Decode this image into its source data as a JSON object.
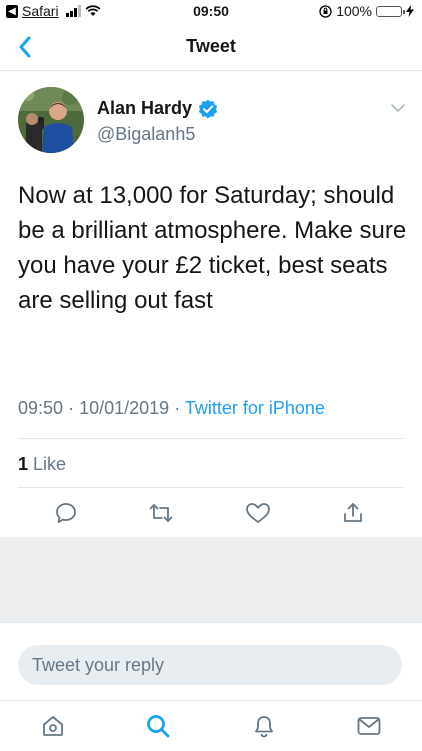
{
  "status_bar": {
    "back_app": "Safari",
    "time": "09:50",
    "battery_percent": "100%",
    "battery_level": 1.0
  },
  "nav": {
    "title": "Tweet"
  },
  "tweet": {
    "author_name": "Alan Hardy",
    "verified": true,
    "handle": "@Bigalanh5",
    "text": "Now at 13,000 for Saturday; should be a brilliant atmosphere. Make sure you have your £2 ticket, best seats are selling out fast",
    "time": "09:50",
    "separator": "·",
    "date": "10/01/2019",
    "source": "Twitter for iPhone",
    "likes_count": "1",
    "likes_label": "Like"
  },
  "actions": {
    "icons": [
      "reply-icon",
      "retweet-icon",
      "like-icon",
      "share-icon"
    ]
  },
  "reply": {
    "placeholder": "Tweet your reply"
  },
  "tab_bar": {
    "tabs": [
      "home-icon",
      "search-icon",
      "notifications-icon",
      "messages-icon"
    ],
    "active_tab": "search-icon"
  },
  "colors": {
    "accent": "#1da1f2",
    "text": "#14171a",
    "secondary_text": "#657786",
    "divider": "#e1e8ed",
    "battery": "#4cd964"
  }
}
